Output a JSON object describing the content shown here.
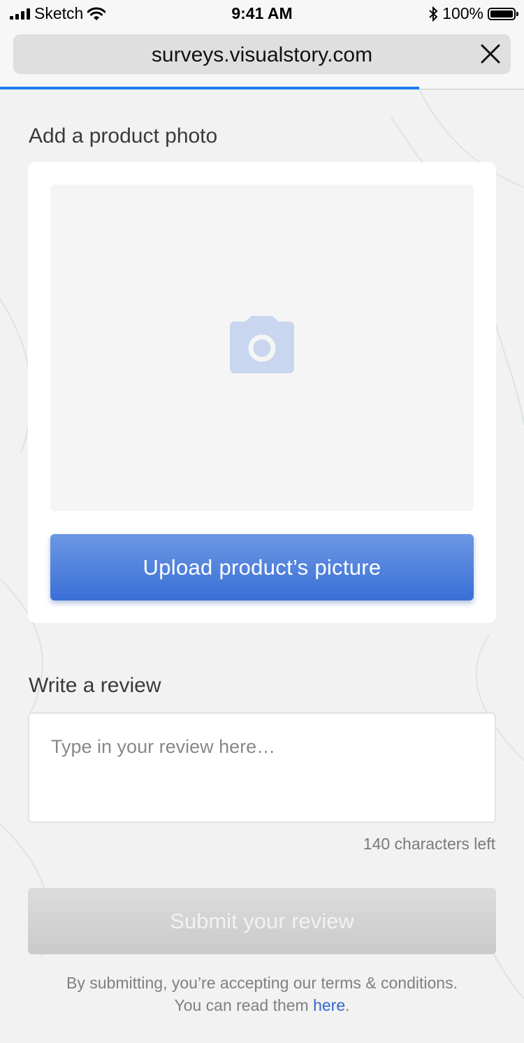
{
  "status_bar": {
    "carrier": "Sketch",
    "time": "9:41 AM",
    "battery": "100%"
  },
  "browser": {
    "url": "surveys.visualstory.com",
    "load_progress": 0.8
  },
  "photo_section": {
    "title": "Add a product photo",
    "upload_label": "Upload product’s picture"
  },
  "review_section": {
    "title": "Write a review",
    "placeholder": "Type in your review here…",
    "chars_left": "140 characters left"
  },
  "submit": {
    "label": "Submit your review"
  },
  "terms": {
    "line1": "By submitting, you’re accepting our terms & conditions.",
    "line2_prefix": "You can read them ",
    "link": "here",
    "line2_suffix": "."
  },
  "colors": {
    "accent": "#3a6fd7",
    "link": "#3368d0",
    "progress": "#1f7cf0",
    "disabled": "#cacaca"
  },
  "icons": [
    "signal-icon",
    "wifi-icon",
    "bluetooth-icon",
    "battery-icon",
    "close-icon",
    "camera-icon"
  ]
}
